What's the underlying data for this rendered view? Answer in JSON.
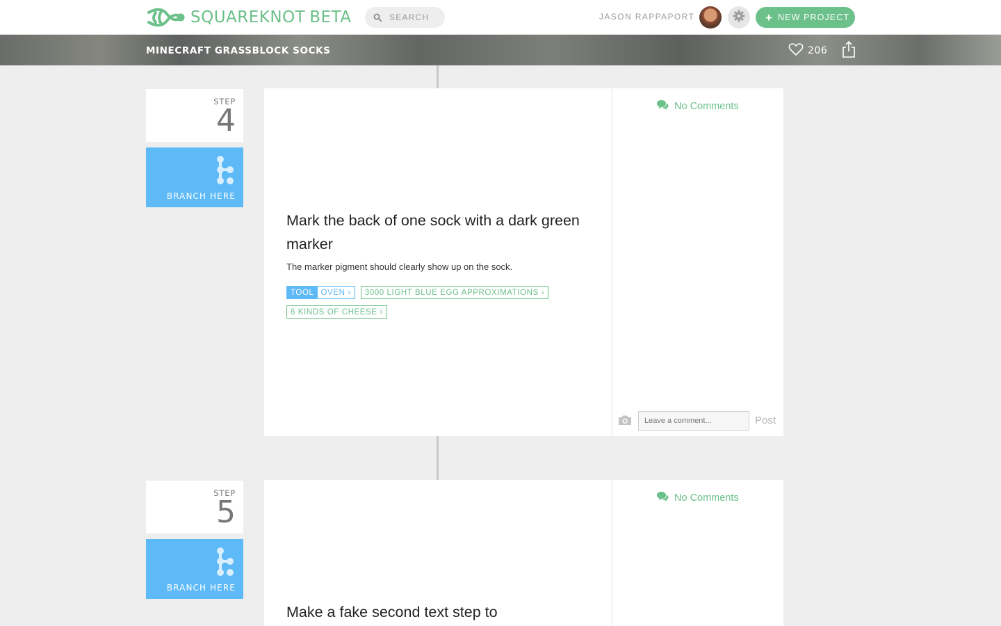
{
  "app": {
    "brand": "SQUAREKNOT",
    "badge": "BETA",
    "search_label": "SEARCH",
    "user_name": "JASON RAPPAPORT",
    "new_project_label": "NEW PROJECT"
  },
  "project": {
    "title": "MINECRAFT GRASSBLOCK SOCKS",
    "likes": "206"
  },
  "steps": [
    {
      "step_label": "STEP",
      "number": "4",
      "branch_label": "BRANCH HERE",
      "title": "Mark the back of one sock with a dark green marker",
      "description": "The marker pigment should clearly show up on the sock.",
      "tool_key": "TOOL",
      "tool_value": "OVEN",
      "materials": [
        "3000 LIGHT BLUE EGG APPROXIMATIONS",
        "6 KINDS OF CHEESE"
      ],
      "comments_label": "No Comments",
      "comment_placeholder": "Leave a comment...",
      "post_label": "Post"
    },
    {
      "step_label": "STEP",
      "number": "5",
      "branch_label": "BRANCH HERE",
      "title": "Make a fake second text step to",
      "comments_label": "No Comments"
    }
  ],
  "colors": {
    "brand_green": "#6cc08a",
    "branch_blue": "#5eb9f7",
    "background": "#eeeeee"
  },
  "icons": [
    "knot-logo-icon",
    "search-icon",
    "gear-icon",
    "plus-icon",
    "heart-icon",
    "share-icon",
    "branch-icon",
    "comments-icon",
    "camera-icon",
    "chevron-right-icon"
  ]
}
